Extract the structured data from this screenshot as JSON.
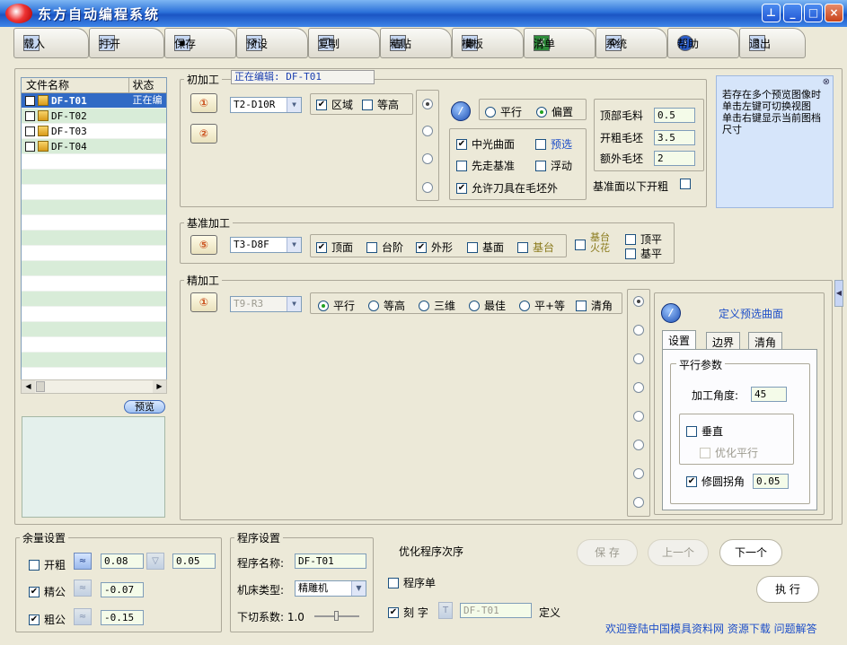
{
  "window": {
    "title": "东方自动编程系统"
  },
  "toolbar": [
    {
      "label": "载入",
      "icon": "load-icon"
    },
    {
      "label": "打开",
      "icon": "open-folder-icon"
    },
    {
      "label": "保存",
      "icon": "save-disk-icon"
    },
    {
      "label": "预设",
      "icon": "cursor-icon"
    },
    {
      "label": "复制",
      "icon": "copy-icon"
    },
    {
      "label": "粘贴",
      "icon": "paste-icon"
    },
    {
      "label": "模板",
      "icon": "template-icon"
    },
    {
      "label": "清单",
      "icon": "excel-icon"
    },
    {
      "label": "系统",
      "icon": "gear-icon"
    },
    {
      "label": "帮助",
      "icon": "help-icon"
    },
    {
      "label": "退出",
      "icon": "exit-door-icon"
    }
  ],
  "file_list": {
    "headers": [
      "文件名称",
      "状态"
    ],
    "rows": [
      {
        "name": "DF-T01",
        "status": "正在编",
        "selected": true
      },
      {
        "name": "DF-T02",
        "status": ""
      },
      {
        "name": "DF-T03",
        "status": ""
      },
      {
        "name": "DF-T04",
        "status": ""
      }
    ],
    "preview_button": "预览"
  },
  "rough": {
    "title": "初加工",
    "editing_label": "正在编辑:  DF-T01",
    "tool1": "T2-D10R",
    "chk_region": "区域",
    "chk_contour": "等高",
    "radio_parallel": "平行",
    "radio_offset": "偏置",
    "chk_center": "中光曲面",
    "chk_preselect": "预选",
    "chk_base_first": "先走基准",
    "chk_float": "浮动",
    "chk_allow_outside": "允许刀具在毛坯外",
    "top_stock_label": "顶部毛料",
    "top_stock_value": "0.5",
    "open_rough_label": "开粗毛坯",
    "open_rough_value": "3.5",
    "extra_stock_label": "额外毛坯",
    "extra_stock_value": "2",
    "below_base_label": "基准面以下开粗"
  },
  "info_panel": {
    "text": "若存在多个预览图像时单击左键可切换视图\n单击右键显示当前图档尺寸"
  },
  "base": {
    "title": "基准加工",
    "tool": "T3-D8F",
    "chk_top": "顶面",
    "chk_step": "台阶",
    "chk_shape": "外形",
    "chk_baseface": "基面",
    "chk_base_table": "基台",
    "label_base_table_opt1": "基台",
    "label_base_table_opt2": "火花",
    "chk_top_flat": "顶平",
    "chk_base_flat": "基平"
  },
  "finish": {
    "title": "精加工",
    "tool": "T9-R3",
    "radio_parallel": "平行",
    "radio_contour": "等高",
    "radio_3d": "三维",
    "radio_best": "最佳",
    "radio_pareq": "平+等",
    "chk_cornerclear": "清角",
    "define_surface": "定义预选曲面",
    "tabs": [
      "设置",
      "边界",
      "清角"
    ],
    "parallel_params": "平行参数",
    "angle_label": "加工角度:",
    "angle_value": "45",
    "chk_vertical": "垂直",
    "chk_optimize_parallel": "优化平行",
    "chk_round_corner": "修圆拐角",
    "round_value": "0.05"
  },
  "allowance": {
    "title": "余量设置",
    "rows": [
      {
        "label": "开粗",
        "checked": false,
        "v1": "0.08",
        "v2": "0.05"
      },
      {
        "label": "精公",
        "checked": true,
        "v1": "-0.07"
      },
      {
        "label": "粗公",
        "checked": true,
        "v1": "-0.15"
      }
    ]
  },
  "program": {
    "title": "程序设置",
    "name_label": "程序名称:",
    "name_value": "DF-T01",
    "machine_label": "机床类型:",
    "machine_value": "精雕机",
    "feed_label": "下切系数: 1.0"
  },
  "order": {
    "title": "优化程序次序",
    "chk_program_list": "程序单",
    "chk_engrave": "刻 字",
    "engrave_value": "DF-T01",
    "define": "定义",
    "btn_save": "保 存",
    "btn_prev": "上一个",
    "btn_next": "下一个",
    "btn_run": "执 行",
    "footer_link": "欢迎登陆中国模具资料网 资源下载 问题解答"
  },
  "colors": {
    "accent": "#2060c8",
    "row_stripe": "#d8ecd8",
    "stock_field": "#f4fbe9"
  }
}
